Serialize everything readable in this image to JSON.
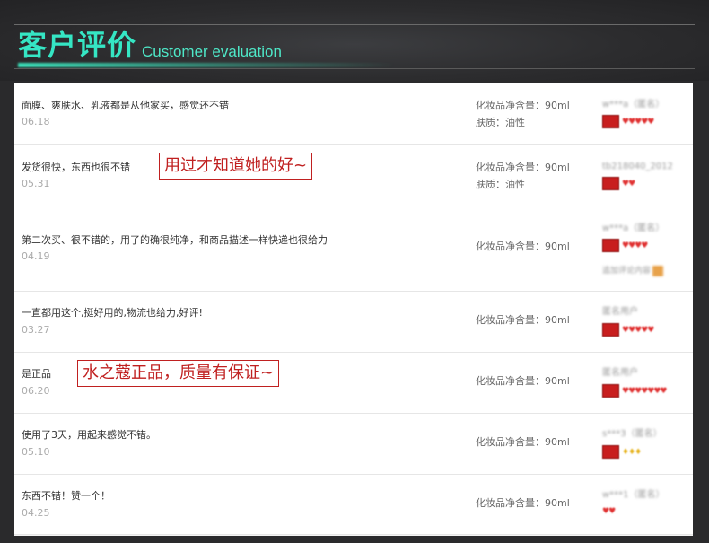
{
  "header": {
    "title_cn": "客户评价",
    "title_en": "Customer evaluation"
  },
  "reviews": [
    {
      "comment": "面膜、爽肤水、乳液都是从他家买，感觉还不错",
      "date": "06.18",
      "spec1": "化妆品净含量：90ml",
      "spec2": "肤质：油性",
      "user": "w***a（匿名）",
      "hearts": "♥♥♥♥♥",
      "extra": ""
    },
    {
      "comment": "发货很快，东西也很不错",
      "date": "05.31",
      "spec1": "化妆品净含量：90ml",
      "spec2": "肤质：油性",
      "user": "tb218040_2012",
      "hearts": "♥♥",
      "extra": ""
    },
    {
      "comment": "第二次买、很不错的，用了的确很纯净，和商品描述一样快递也很给力",
      "date": "04.19",
      "spec1": "化妆品净含量：90ml",
      "spec2": "",
      "user": "w***a（匿名）",
      "hearts": "♥♥♥♥",
      "extra": "追加评论内容"
    },
    {
      "comment": "一直都用这个,挺好用的,物流也给力,好评!",
      "date": "03.27",
      "spec1": "化妆品净含量：90ml",
      "spec2": "",
      "user": "匿名用户",
      "hearts": "♥♥♥♥♥",
      "extra": ""
    },
    {
      "comment": "是正品",
      "date": "06.20",
      "spec1": "化妆品净含量：90ml",
      "spec2": "",
      "user": "匿名用户",
      "hearts": "♥♥♥♥♥♥♥",
      "extra": ""
    },
    {
      "comment": "使用了3天，用起来感觉不错。",
      "date": "05.10",
      "spec1": "化妆品净含量：90ml",
      "spec2": "",
      "user": "s***3（匿名）",
      "hearts": "♦♦♦",
      "extra": ""
    },
    {
      "comment": "东西不错！赞一个！",
      "date": "04.25",
      "spec1": "化妆品净含量：90ml",
      "spec2": "",
      "user": "w***1（匿名）",
      "hearts": "♥♥",
      "extra": ""
    }
  ],
  "annotations": {
    "note1": "用过才知道她的好~",
    "note2": "水之蔻正品，质量有保证~"
  }
}
